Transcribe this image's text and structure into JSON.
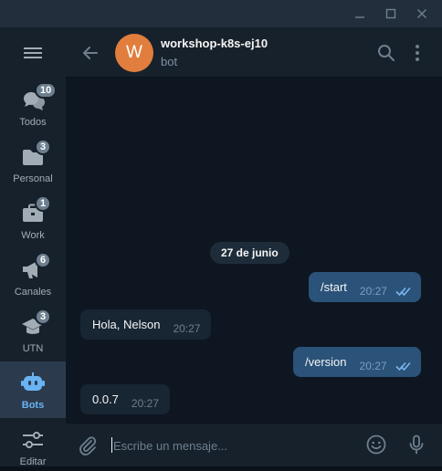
{
  "window": {
    "controls": [
      {
        "name": "minimize",
        "icon": "minimize-icon"
      },
      {
        "name": "maximize",
        "icon": "maximize-icon"
      },
      {
        "name": "close",
        "icon": "close-icon"
      }
    ]
  },
  "sidebar": {
    "menu_icon": "hamburger-menu-icon",
    "folders": [
      {
        "id": "todos",
        "label": "Todos",
        "badge": "10",
        "icon": "chats-icon",
        "active": false
      },
      {
        "id": "personal",
        "label": "Personal",
        "badge": "3",
        "icon": "folder-icon",
        "active": false
      },
      {
        "id": "work",
        "label": "Work",
        "badge": "1",
        "icon": "briefcase-icon",
        "active": false
      },
      {
        "id": "canales",
        "label": "Canales",
        "badge": "6",
        "icon": "megaphone-icon",
        "active": false
      },
      {
        "id": "utn",
        "label": "UTN",
        "badge": "3",
        "icon": "graduation-cap-icon",
        "active": false
      },
      {
        "id": "bots",
        "label": "Bots",
        "badge": "",
        "icon": "robot-icon",
        "active": true
      },
      {
        "id": "editar",
        "label": "Editar",
        "badge": "",
        "icon": "sliders-icon",
        "active": false
      }
    ]
  },
  "header": {
    "avatar_letter": "W",
    "title": "workshop-k8s-ej10",
    "status": "bot"
  },
  "messages": {
    "date_separator": "27 de junio",
    "items": [
      {
        "direction": "out",
        "text": "/start",
        "time": "20:27",
        "read": true
      },
      {
        "direction": "in",
        "text": "Hola, Nelson",
        "time": "20:27"
      },
      {
        "direction": "out",
        "text": "/version",
        "time": "20:27",
        "read": true
      },
      {
        "direction": "in",
        "text": "0.0.7",
        "time": "20:27"
      }
    ]
  },
  "composer": {
    "placeholder": "Escribe un mensaje..."
  },
  "colors": {
    "background": "#0e1621",
    "panel": "#17212b",
    "outgoing_bubble": "#2b5278",
    "incoming_bubble": "#182533",
    "accent": "#6ab3f3",
    "avatar": "#e17e3d",
    "badge": "#6d7f8f"
  }
}
